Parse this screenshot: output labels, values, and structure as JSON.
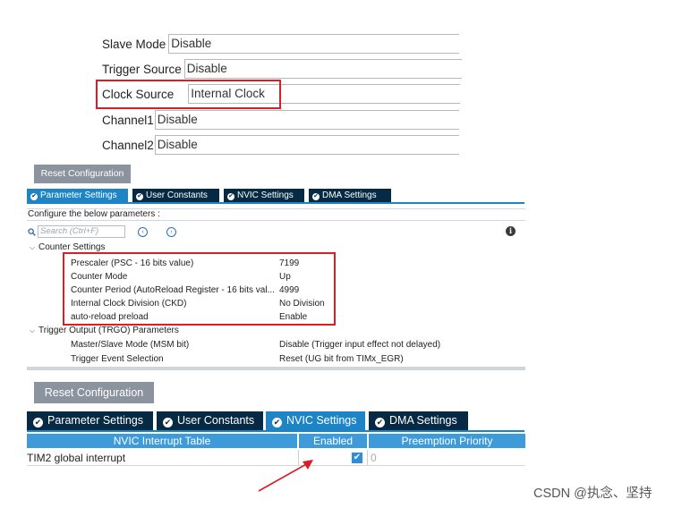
{
  "mode": {
    "rows": [
      {
        "label": "Slave Mode",
        "value": "Disable"
      },
      {
        "label": "Trigger Source",
        "value": "Disable"
      },
      {
        "label": "Clock Source",
        "value": "Internal Clock"
      },
      {
        "label": "Channel1",
        "value": "Disable"
      },
      {
        "label": "Channel2",
        "value": "Disable"
      }
    ]
  },
  "config_small": {
    "reset_label": "Reset Configuration",
    "tabs": [
      "Parameter Settings",
      "User Constants",
      "NVIC Settings",
      "DMA Settings"
    ],
    "active_tab": "Parameter Settings",
    "configure_text": "Configure the below parameters :",
    "search_placeholder": "Search (Ctrl+F)",
    "groups": [
      {
        "name": "Counter Settings",
        "params": [
          {
            "name": "Prescaler (PSC - 16 bits value)",
            "value": "7199"
          },
          {
            "name": "Counter Mode",
            "value": "Up"
          },
          {
            "name": "Counter Period (AutoReload Register - 16 bits val...",
            "value": "4999"
          },
          {
            "name": "Internal Clock Division (CKD)",
            "value": "No Division"
          },
          {
            "name": "auto-reload preload",
            "value": "Enable"
          }
        ]
      },
      {
        "name": "Trigger Output (TRGO) Parameters",
        "params": [
          {
            "name": "Master/Slave Mode (MSM bit)",
            "value": "Disable (Trigger input effect not delayed)"
          },
          {
            "name": "Trigger Event Selection",
            "value": "Reset (UG bit from TIMx_EGR)"
          }
        ]
      }
    ]
  },
  "config_large": {
    "reset_label": "Reset Configuration",
    "tabs": [
      "Parameter Settings",
      "User Constants",
      "NVIC Settings",
      "DMA Settings"
    ],
    "active_tab": "NVIC Settings",
    "table": {
      "headers": [
        "NVIC Interrupt Table",
        "Enabled",
        "Preemption Priority"
      ],
      "rows": [
        {
          "name": "TIM2 global interrupt",
          "enabled": true,
          "priority": "0"
        }
      ]
    }
  },
  "icons": {
    "check": "✔",
    "caret_down": "⌵",
    "prev": "‹",
    "next": "›",
    "info": "i",
    "search": "search-icon"
  },
  "colors": {
    "highlight": "#d81e27",
    "tab_active": "#1d85c6",
    "tab_inactive": "#062a44",
    "table_header": "#3e9bd9"
  },
  "watermark": "CSDN @执念、坚持"
}
